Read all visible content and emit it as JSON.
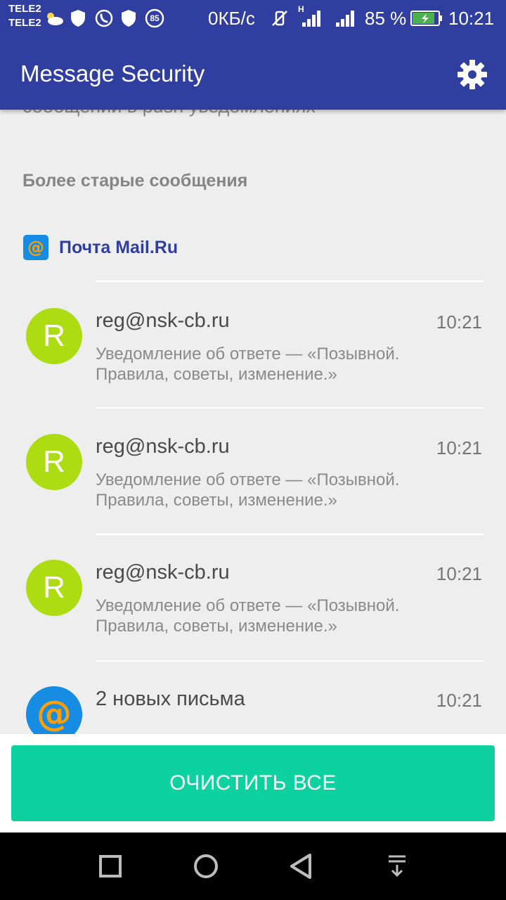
{
  "status_bar": {
    "carrier_1": "TELE2",
    "carrier_2": "TELE2",
    "network_speed": "0КБ/с",
    "notification_badge": "85",
    "network_type": "H",
    "battery_percent": "85 %",
    "battery_level": 0.85,
    "time": "10:21",
    "icons": [
      "weather-icon",
      "shield-icon",
      "phone-icon",
      "shield-icon",
      "badge-85-icon",
      "vibrate-off-icon",
      "signal-icon",
      "signal-icon",
      "battery-charging-icon"
    ]
  },
  "app_bar": {
    "title": "Message Security",
    "settings_icon": "gear-icon"
  },
  "content": {
    "cut_off_text": "сообщений в push уведомлениях",
    "section_title": "Более старые сообщения",
    "app_name": "Почта Mail.Ru",
    "app_icon": "mailru-at-icon",
    "messages": [
      {
        "avatar_letter": "R",
        "sender": "reg@nsk-cb.ru",
        "time": "10:21",
        "preview": "Уведомление об ответе — «Позывной. Правила, советы, изменение.»"
      },
      {
        "avatar_letter": "R",
        "sender": "reg@nsk-cb.ru",
        "time": "10:21",
        "preview": "Уведомление об ответе — «Позывной. Правила, советы, изменение.»"
      },
      {
        "avatar_letter": "R",
        "sender": "reg@nsk-cb.ru",
        "time": "10:21",
        "preview": "Уведомление об ответе — «Позывной. Правила, советы, изменение.»"
      },
      {
        "avatar_icon": "mailru-at-icon",
        "sender": "2 новых письма",
        "time": "10:21",
        "preview": ""
      }
    ]
  },
  "footer": {
    "clear_all_label": "ОЧИСТИТЬ ВСЕ"
  },
  "nav_bar": {
    "icons": [
      "recent-apps-icon",
      "home-icon",
      "back-icon",
      "notifications-pull-icon"
    ]
  },
  "colors": {
    "app_bar": "#303f9f",
    "avatar": "#aedc12",
    "accent_button": "#0dd19e",
    "app_name": "#303f9f"
  }
}
